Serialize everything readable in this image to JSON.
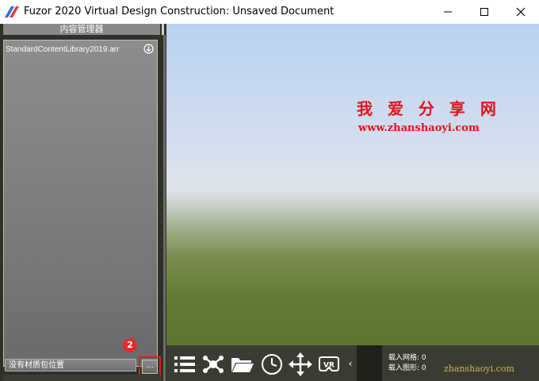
{
  "window": {
    "title": "Fuzor 2020 Virtual Design Construction: Unsaved Document"
  },
  "content_manager": {
    "header": "内容管理器",
    "items": [
      {
        "label": "StandardContentLibrary2019.arr"
      }
    ],
    "path_field_value": "没有材质包位置",
    "browse_label": "...",
    "step_badge": "2"
  },
  "viewport": {
    "watermark_title": "我 爱 分 享 网",
    "watermark_url": "www.zhanshaoyi.com"
  },
  "status": {
    "meshes_label": "载入网格",
    "meshes_value": "0",
    "shapes_label": "载入图形",
    "shapes_value": "0",
    "watermark": "zhanshaoyi.com"
  },
  "toolbar": {
    "tools": [
      "list-icon",
      "nodes-icon",
      "folder-icon",
      "clock-icon",
      "move-icon",
      "vr-icon"
    ],
    "vr_label": "VR",
    "collapse": "‹"
  }
}
